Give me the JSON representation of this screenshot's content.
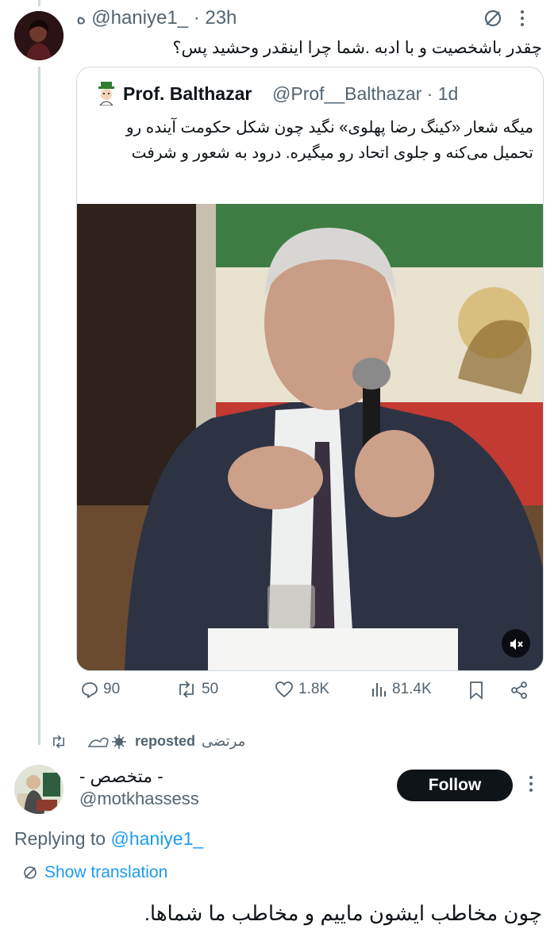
{
  "tweet1": {
    "handle": "@haniye1_",
    "name_suffix": "ه",
    "time": "· 23h",
    "text": "چقدر باشخصیت و با ادبه .شما چرا اینقدر وحشید پس؟"
  },
  "quote": {
    "name": "Prof. Balthazar",
    "handle": "@Prof__Balthazar · 1d",
    "text": "میگه شعار «کینگ رضا پهلوی» نگید چون شکل حکومت آینده رو تحمیل می‌کنه و جلوی اتحاد رو میگیره. درود به شعور و شرفت"
  },
  "actions": {
    "replies": "90",
    "reposts": "50",
    "likes": "1.8K",
    "views": "81.4K"
  },
  "repost_row": {
    "label": "مرتضی",
    "suffix": "reposted"
  },
  "tweet2": {
    "name": "- متخصص -",
    "handle": "@motkhassess",
    "follow_label": "Follow",
    "replying_prefix": "Replying to",
    "replying_handle": "@haniye1_",
    "show_translation": "Show translation",
    "text": "چون مخاطب ایشون ماییم و مخاطب ما شماها."
  },
  "colors": {
    "accent": "#1d9bf0",
    "muted": "#536471",
    "border": "#cfd9de"
  }
}
